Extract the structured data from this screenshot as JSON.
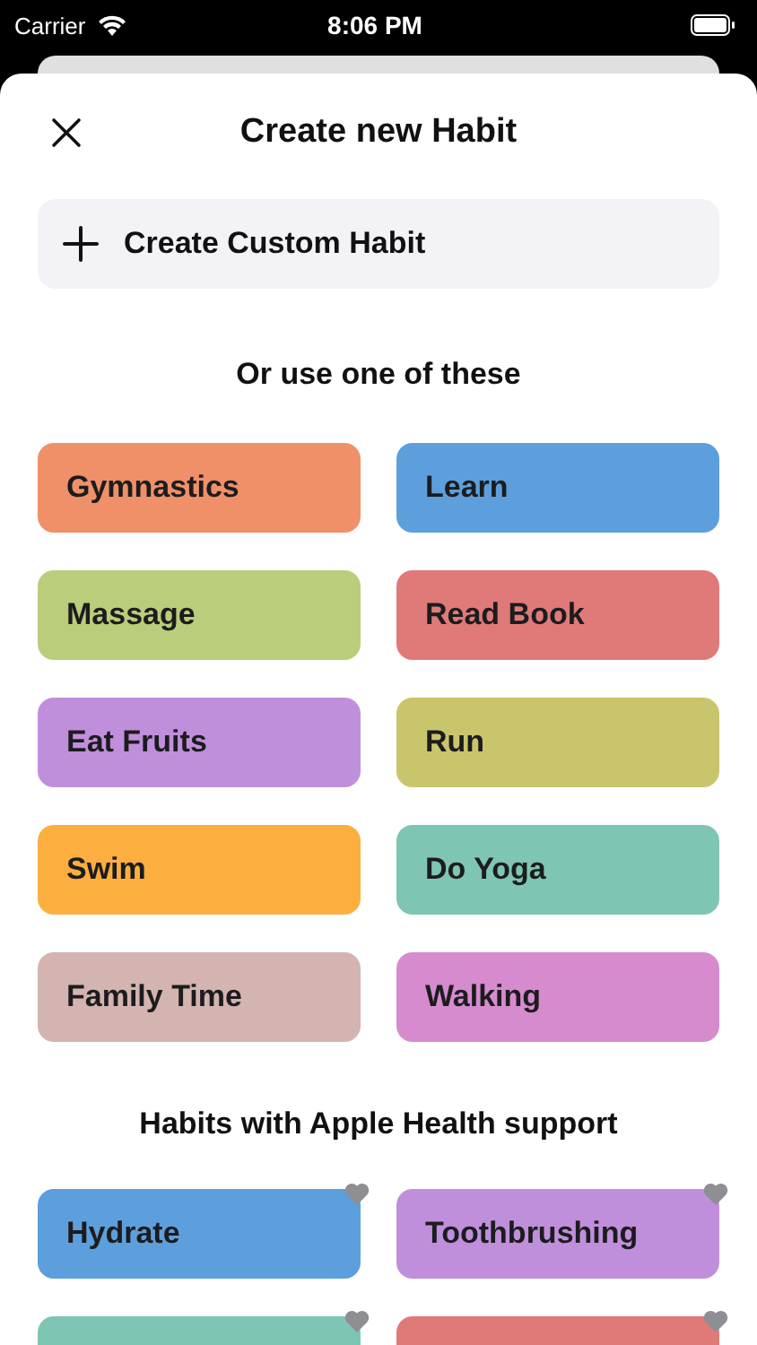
{
  "status_bar": {
    "carrier": "Carrier",
    "time": "8:06 PM"
  },
  "header": {
    "title": "Create new Habit"
  },
  "custom_button": {
    "label": "Create Custom Habit"
  },
  "suggestions": {
    "heading": "Or use one of these",
    "items": [
      {
        "label": "Gymnastics",
        "color": "#ef9068"
      },
      {
        "label": "Learn",
        "color": "#5d9fdc"
      },
      {
        "label": "Massage",
        "color": "#b9cd7b"
      },
      {
        "label": "Read Book",
        "color": "#df7a79"
      },
      {
        "label": "Eat Fruits",
        "color": "#c08fdc"
      },
      {
        "label": "Run",
        "color": "#c9c56c"
      },
      {
        "label": "Swim",
        "color": "#fcaf3e"
      },
      {
        "label": "Do Yoga",
        "color": "#7fc5b4"
      },
      {
        "label": "Family Time",
        "color": "#d3b4b1"
      },
      {
        "label": "Walking",
        "color": "#d68bcf"
      }
    ]
  },
  "health": {
    "heading": "Habits with Apple Health support",
    "items": [
      {
        "label": "Hydrate",
        "color": "#5d9fdc"
      },
      {
        "label": "Toothbrushing",
        "color": "#c08fdc"
      },
      {
        "color": "#7fc5b4"
      },
      {
        "color": "#df7a79"
      }
    ]
  }
}
